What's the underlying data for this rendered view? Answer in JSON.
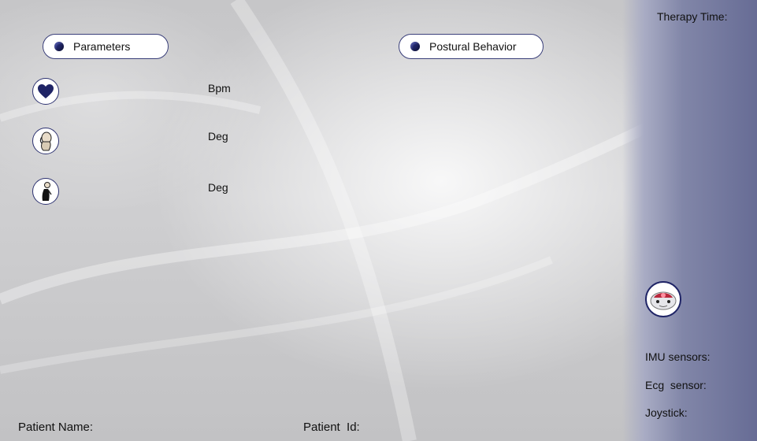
{
  "header": {
    "therapy_time_label": "Therapy Time:"
  },
  "tabs": {
    "parameters_label": "Parameters",
    "postural_behavior_label": "Postural Behavior"
  },
  "parameters": {
    "heart_rate_unit": "Bpm",
    "head_angle_unit": "Deg",
    "trunk_angle_unit": "Deg",
    "icons": [
      "heart-icon",
      "head-tilt-icon",
      "trunk-posture-icon"
    ]
  },
  "sensors": {
    "robot_icon": "robot-icon",
    "imu_label": "IMU sensors:",
    "ecg_label": "Ecg  sensor:",
    "joystick_label": "Joystick:"
  },
  "footer": {
    "patient_name_label": "Patient Name:",
    "patient_id_label": "Patient  Id:"
  },
  "colors": {
    "accent": "#1f2466",
    "sidebar": "#676c95",
    "background": "#c6c6c8"
  }
}
